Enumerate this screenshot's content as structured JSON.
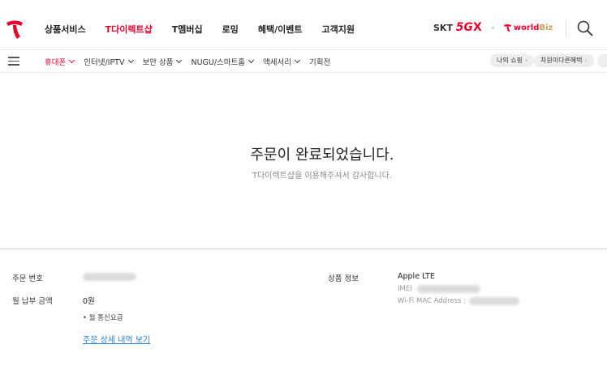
{
  "header": {
    "nav": [
      {
        "label": "상품서비스",
        "active": false
      },
      {
        "label": "T다이렉트샵",
        "active": true
      },
      {
        "label": "T멤버십",
        "active": false
      },
      {
        "label": "로밍",
        "active": false
      },
      {
        "label": "혜택/이벤트",
        "active": false
      },
      {
        "label": "고객지원",
        "active": false
      }
    ],
    "brand_skt_prefix": "SKT",
    "brand_5g": "5G",
    "brand_x": "X",
    "brand_worldbiz_w": "world",
    "brand_worldbiz_b": "Biz",
    "brand_color": "#ea002c",
    "icons": {
      "logo": "t-logo-icon",
      "search": "search-icon",
      "menu": "hamburger-menu-icon"
    }
  },
  "subnav": {
    "categories": [
      {
        "label": "휴대폰",
        "active": true
      },
      {
        "label": "인터넷/IPTV",
        "active": false
      },
      {
        "label": "보안 상품",
        "active": false
      },
      {
        "label": "NUGU/스마트홈",
        "active": false
      },
      {
        "label": "액세서리",
        "active": false
      },
      {
        "label": "기획전",
        "active": false,
        "no_chevron": true
      }
    ],
    "my_shopping": "나의 쇼핑",
    "benefits": "차원이다른혜택"
  },
  "completion": {
    "title": "주문이 완료되었습니다.",
    "subtitle": "T다이렉트샵을 이용해주셔서 감사합니다."
  },
  "order": {
    "number_label": "주문 번호",
    "monthly_label": "월 납부 금액",
    "monthly_value": "0원",
    "monthly_note": "• 월 통신요금",
    "detail_link": "주문 상세 내역 보기",
    "product_label": "상품 정보",
    "product_name": "Apple LTE",
    "imei_label": "IMEI",
    "wifi_label": "Wi-Fi MAC Address :"
  }
}
